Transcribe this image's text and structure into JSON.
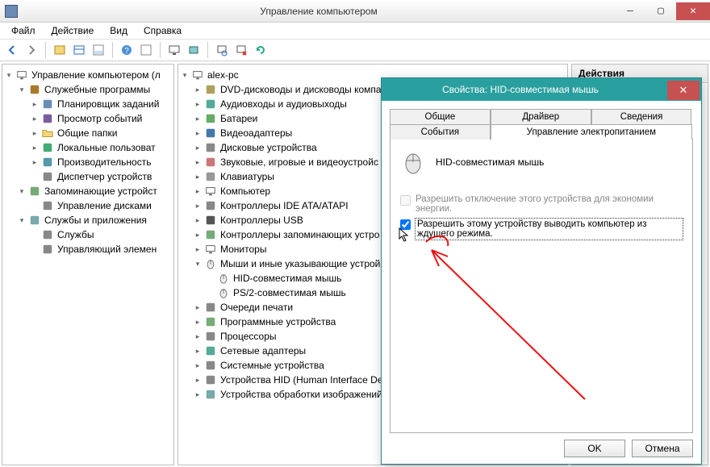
{
  "window": {
    "title": "Управление компьютером",
    "menu": {
      "file": "Файл",
      "action": "Действие",
      "view": "Вид",
      "help": "Справка"
    },
    "actions_header": "Действия"
  },
  "left_tree": [
    {
      "d": 0,
      "exp": "open",
      "icon": "computer",
      "label": "Управление компьютером (л"
    },
    {
      "d": 1,
      "exp": "open",
      "icon": "tools",
      "label": "Служебные программы"
    },
    {
      "d": 2,
      "exp": "closed",
      "icon": "clock",
      "label": "Планировщик заданий"
    },
    {
      "d": 2,
      "exp": "closed",
      "icon": "event",
      "label": "Просмотр событий"
    },
    {
      "d": 2,
      "exp": "closed",
      "icon": "folder",
      "label": "Общие папки"
    },
    {
      "d": 2,
      "exp": "closed",
      "icon": "users",
      "label": "Локальные пользоват"
    },
    {
      "d": 2,
      "exp": "closed",
      "icon": "perf",
      "label": "Производительность"
    },
    {
      "d": 2,
      "exp": "none",
      "icon": "devmgr",
      "label": "Диспетчер устройств"
    },
    {
      "d": 1,
      "exp": "open",
      "icon": "storage",
      "label": "Запоминающие устройст"
    },
    {
      "d": 2,
      "exp": "none",
      "icon": "disk",
      "label": "Управление дисками"
    },
    {
      "d": 1,
      "exp": "open",
      "icon": "services",
      "label": "Службы и приложения"
    },
    {
      "d": 2,
      "exp": "none",
      "icon": "gear",
      "label": "Службы"
    },
    {
      "d": 2,
      "exp": "none",
      "icon": "wmi",
      "label": "Управляющий элемен"
    }
  ],
  "device_tree": [
    {
      "d": 0,
      "exp": "open",
      "icon": "pc",
      "label": "alex-pc"
    },
    {
      "d": 1,
      "exp": "closed",
      "icon": "dvd",
      "label": "DVD-дисководы и дисководы компа"
    },
    {
      "d": 1,
      "exp": "closed",
      "icon": "audio",
      "label": "Аудиовходы и аудиовыходы"
    },
    {
      "d": 1,
      "exp": "closed",
      "icon": "battery",
      "label": "Батареи"
    },
    {
      "d": 1,
      "exp": "closed",
      "icon": "video",
      "label": "Видеоадаптеры"
    },
    {
      "d": 1,
      "exp": "closed",
      "icon": "hdd",
      "label": "Дисковые устройства"
    },
    {
      "d": 1,
      "exp": "closed",
      "icon": "sound",
      "label": "Звуковые, игровые и видеоустройс"
    },
    {
      "d": 1,
      "exp": "closed",
      "icon": "keyboard",
      "label": "Клавиатуры"
    },
    {
      "d": 1,
      "exp": "closed",
      "icon": "pc",
      "label": "Компьютер"
    },
    {
      "d": 1,
      "exp": "closed",
      "icon": "ide",
      "label": "Контроллеры IDE ATA/ATAPI"
    },
    {
      "d": 1,
      "exp": "closed",
      "icon": "usb",
      "label": "Контроллеры USB"
    },
    {
      "d": 1,
      "exp": "closed",
      "icon": "storage2",
      "label": "Контроллеры запоминающих устро"
    },
    {
      "d": 1,
      "exp": "closed",
      "icon": "monitor",
      "label": "Мониторы"
    },
    {
      "d": 1,
      "exp": "open",
      "icon": "mouse",
      "label": "Мыши и иные указывающие устрой"
    },
    {
      "d": 2,
      "exp": "none",
      "icon": "mouse",
      "label": "HID-совместимая мышь"
    },
    {
      "d": 2,
      "exp": "none",
      "icon": "mouse",
      "label": "PS/2-совместимая мышь"
    },
    {
      "d": 1,
      "exp": "closed",
      "icon": "printer",
      "label": "Очереди печати"
    },
    {
      "d": 1,
      "exp": "closed",
      "icon": "software",
      "label": "Программные устройства"
    },
    {
      "d": 1,
      "exp": "closed",
      "icon": "cpu",
      "label": "Процессоры"
    },
    {
      "d": 1,
      "exp": "closed",
      "icon": "net",
      "label": "Сетевые адаптеры"
    },
    {
      "d": 1,
      "exp": "closed",
      "icon": "system",
      "label": "Системные устройства"
    },
    {
      "d": 1,
      "exp": "closed",
      "icon": "hid",
      "label": "Устройства HID (Human Interface Dev"
    },
    {
      "d": 1,
      "exp": "closed",
      "icon": "image",
      "label": "Устройства обработки изображений"
    }
  ],
  "dialog": {
    "title": "Свойства: HID-совместимая мышь",
    "tabs": {
      "general": "Общие",
      "driver": "Драйвер",
      "details": "Сведения",
      "events": "События",
      "power": "Управление электропитанием"
    },
    "device_name": "HID-совместимая мышь",
    "check1": "Разрешить отключение этого устройства для экономии энергии.",
    "check2": "Разрешить этому устройству выводить компьютер из ждущего режима.",
    "check1_checked": false,
    "check1_enabled": false,
    "check2_checked": true,
    "ok": "OK",
    "cancel": "Отмена"
  }
}
